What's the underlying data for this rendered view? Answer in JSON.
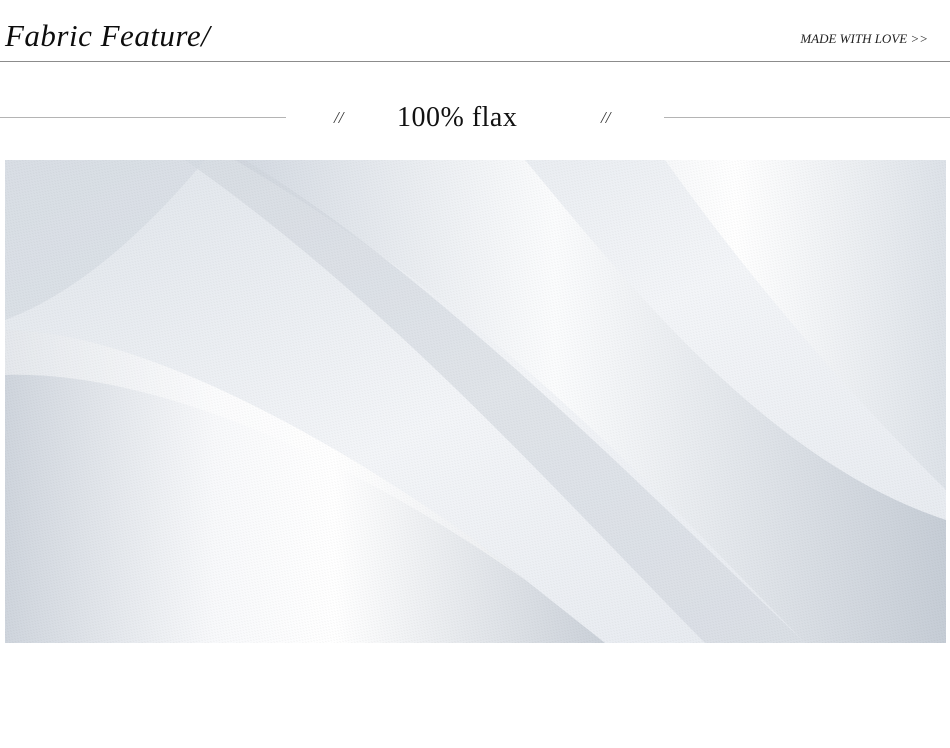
{
  "header": {
    "title": "Fabric Feature/",
    "tagline": "MADE WITH LOVE >>"
  },
  "section": {
    "left_mark": "//",
    "subtitle": "100% flax",
    "right_mark": "//"
  },
  "photo": {
    "subject": "",
    "colors": {
      "highlight": "#ffffff",
      "light": "#eef1f5",
      "mid": "#d9dee6",
      "shadow": "#bcc3cd"
    }
  }
}
